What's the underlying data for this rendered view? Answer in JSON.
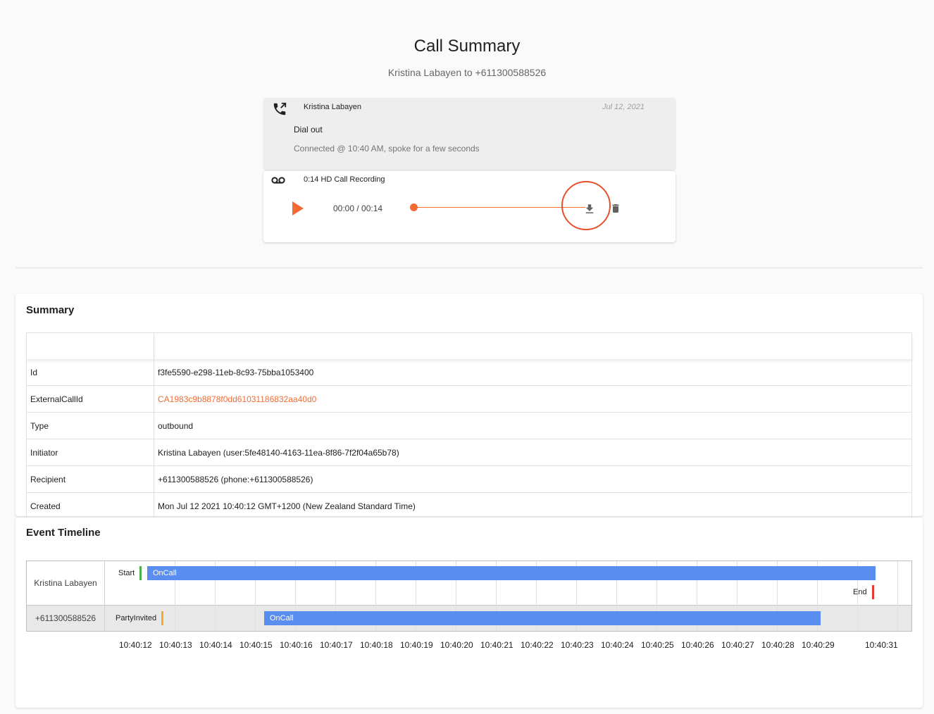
{
  "header": {
    "title": "Call Summary",
    "subtitle": "Kristina Labayen to +611300588526"
  },
  "call_card": {
    "caller": "Kristina Labayen",
    "date": "Jul 12, 2021",
    "type": "Dial out",
    "status": "Connected @ 10:40 AM, spoke for a few seconds",
    "icon": "phone-outgoing-icon"
  },
  "recording": {
    "label": "0:14 HD Call Recording",
    "time": "00:00 / 00:14",
    "progress": 0,
    "accent_color": "#f26b33",
    "highlight_color": "#e4502b"
  },
  "summary": {
    "title": "Summary",
    "rows": [
      {
        "key": "Id",
        "value": "f3fe5590-e298-11eb-8c93-75bba1053400"
      },
      {
        "key": "ExternalCallId",
        "value": "CA1983c9b8878f0dd61031186832aa40d0"
      },
      {
        "key": "Type",
        "value": "outbound"
      },
      {
        "key": "Initiator",
        "value": "Kristina Labayen (user:5fe48140-4163-11ea-8f86-7f2f04a65b78)"
      },
      {
        "key": "Recipient",
        "value": "+611300588526 (phone:+611300588526)"
      },
      {
        "key": "Created",
        "value": "Mon Jul 12 2021 10:40:12 GMT+1200 (New Zealand Standard Time)"
      }
    ]
  },
  "timeline": {
    "title": "Event Timeline",
    "rows": [
      {
        "name": "Kristina Labayen"
      },
      {
        "name": "+611300588526"
      }
    ],
    "events": {
      "start_label": "Start",
      "oncall_label": "OnCall",
      "end_label": "End",
      "party_invited_label": "PartyInvited"
    },
    "ticks": [
      "10:40:12",
      "10:40:13",
      "10:40:14",
      "10:40:15",
      "10:40:16",
      "10:40:17",
      "10:40:18",
      "10:40:19",
      "10:40:20",
      "10:40:21",
      "10:40:22",
      "10:40:23",
      "10:40:24",
      "10:40:25",
      "10:40:26",
      "10:40:27",
      "10:40:28",
      "10:40:29",
      "10:40:31"
    ],
    "colors": {
      "bar": "#5a8df0",
      "start": "#4caf50",
      "end": "#e53935",
      "invited": "#f9a825"
    }
  }
}
